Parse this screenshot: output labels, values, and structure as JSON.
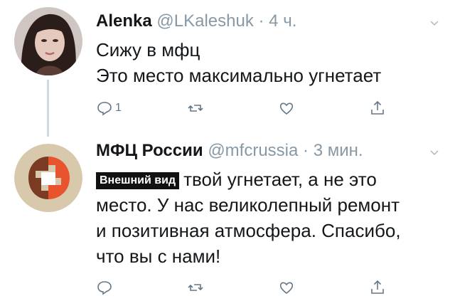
{
  "tweets": [
    {
      "author_name": "Alenka",
      "handle": "@LKaleshuk",
      "separator": "·",
      "time": "4 ч.",
      "lines": [
        "Сижу в мфц",
        "Это место максимально угнетает"
      ],
      "actions": {
        "reply_count": "1"
      },
      "avatar": "profile-photo"
    },
    {
      "author_name": "МФЦ России",
      "handle": "@mfcrussia",
      "separator": "·",
      "time": "3 мин.",
      "overlay_label": "Внешний вид",
      "first_line_rest": "твой угнетает, а не это",
      "lines": [
        "место. У нас великолепный ремонт",
        "и позитивная атмосфера. Спасибо,",
        "что вы с нами!"
      ],
      "avatar": "mfc-logo"
    }
  ],
  "colors": {
    "secondary_text": "#8899a6",
    "icon": "#657786",
    "logo_brown": "#7a3b22",
    "logo_orange": "#e8542d",
    "logo_beige": "#d8c9ad"
  }
}
